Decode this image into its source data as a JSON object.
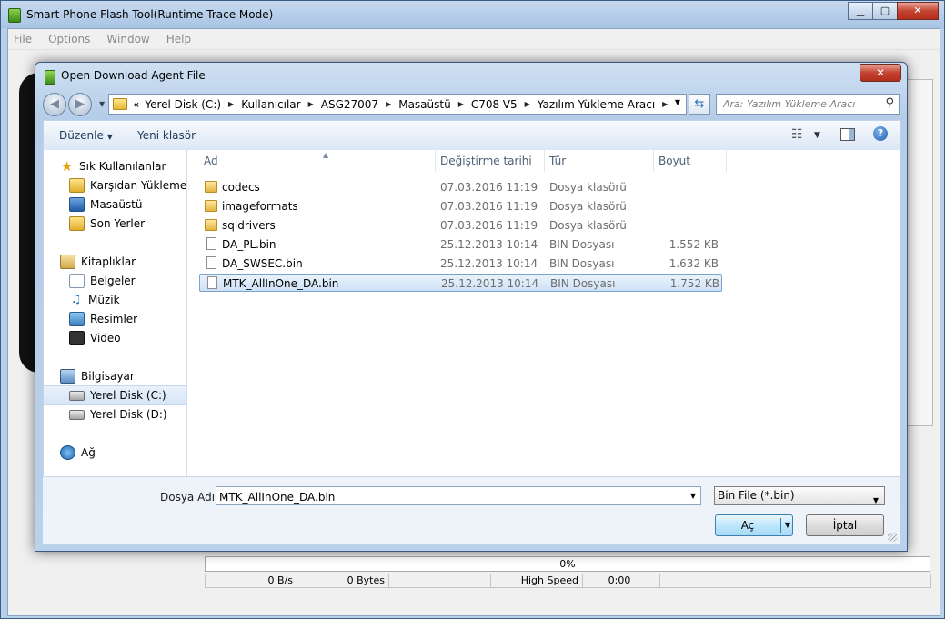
{
  "main_window": {
    "title": "Smart Phone Flash Tool(Runtime Trace Mode)",
    "controls": {
      "minimize": "▁",
      "maximize": "▢",
      "close": "✕"
    },
    "menu": [
      "File",
      "Options",
      "Window",
      "Help"
    ],
    "progress_text": "0%",
    "status": {
      "speed": "0 B/s",
      "bytes": "0 Bytes",
      "mode": "High Speed",
      "time": "0:00"
    }
  },
  "dialog": {
    "title": "Open Download Agent File",
    "close": "✕",
    "breadcrumb": [
      "Yerel Disk (C:)",
      "Kullanıcılar",
      "ASG27007",
      "Masaüstü",
      "C708-V5",
      "Yazılım Yükleme Aracı"
    ],
    "breadcrumb_prefix": "«",
    "search_placeholder": "Ara: Yazılım Yükleme Aracı",
    "toolbar": {
      "organize": "Düzenle",
      "new_folder": "Yeni klasör"
    },
    "nav": {
      "favorites": {
        "label": "Sık Kullanılanlar",
        "items": [
          "Karşıdan Yüklemeler",
          "Masaüstü",
          "Son Yerler"
        ]
      },
      "libraries": {
        "label": "Kitaplıklar",
        "items": [
          "Belgeler",
          "Müzik",
          "Resimler",
          "Video"
        ]
      },
      "computer": {
        "label": "Bilgisayar",
        "items": [
          "Yerel Disk (C:)",
          "Yerel Disk (D:)"
        ]
      },
      "network": {
        "label": "Ağ"
      }
    },
    "columns": {
      "name": "Ad",
      "date": "Değiştirme tarihi",
      "type": "Tür",
      "size": "Boyut"
    },
    "files": [
      {
        "name": "codecs",
        "date": "07.03.2016 11:19",
        "type": "Dosya klasörü",
        "size": "",
        "kind": "folder"
      },
      {
        "name": "imageformats",
        "date": "07.03.2016 11:19",
        "type": "Dosya klasörü",
        "size": "",
        "kind": "folder"
      },
      {
        "name": "sqldrivers",
        "date": "07.03.2016 11:19",
        "type": "Dosya klasörü",
        "size": "",
        "kind": "folder"
      },
      {
        "name": "DA_PL.bin",
        "date": "25.12.2013 10:14",
        "type": "BIN Dosyası",
        "size": "1.552 KB",
        "kind": "file"
      },
      {
        "name": "DA_SWSEC.bin",
        "date": "25.12.2013 10:14",
        "type": "BIN Dosyası",
        "size": "1.632 KB",
        "kind": "file"
      },
      {
        "name": "MTK_AllInOne_DA.bin",
        "date": "25.12.2013 10:14",
        "type": "BIN Dosyası",
        "size": "1.752 KB",
        "kind": "file"
      }
    ],
    "selected_file": "MTK_AllInOne_DA.bin",
    "filename_label": "Dosya Adı:",
    "filename_value": "MTK_AllInOne_DA.bin",
    "filetype": "Bin File (*.bin)",
    "open_button": "Aç",
    "cancel_button": "İptal"
  },
  "colors": {
    "selection": "#cfe2f7",
    "accent": "#3c7fb1",
    "close": "#c24431"
  }
}
